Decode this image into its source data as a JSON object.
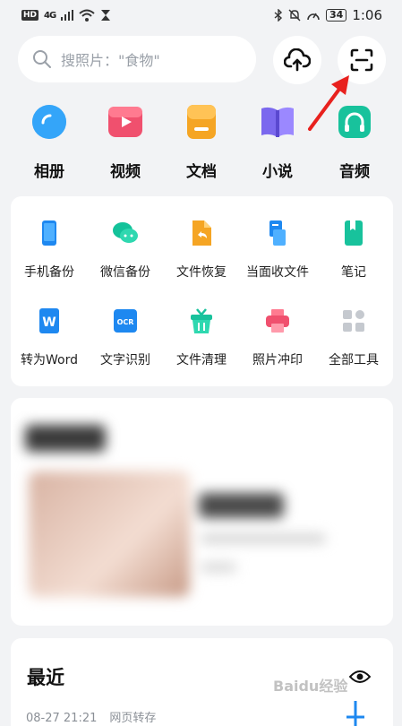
{
  "status_bar": {
    "hd": "HD",
    "network": "4G",
    "battery": "34",
    "time": "1:06"
  },
  "search": {
    "placeholder": "搜照片：\"食物\""
  },
  "categories": [
    {
      "label": "相册",
      "icon": "album-icon",
      "color": "#1e90f0"
    },
    {
      "label": "视频",
      "icon": "video-icon",
      "color": "#f0506e"
    },
    {
      "label": "文档",
      "icon": "document-icon",
      "color": "#f5a524"
    },
    {
      "label": "小说",
      "icon": "novel-icon",
      "color": "#7b68ee"
    },
    {
      "label": "音频",
      "icon": "audio-icon",
      "color": "#18c29c"
    }
  ],
  "tools": [
    {
      "label": "手机备份",
      "icon": "phone-backup-icon"
    },
    {
      "label": "微信备份",
      "icon": "wechat-backup-icon"
    },
    {
      "label": "文件恢复",
      "icon": "file-restore-icon"
    },
    {
      "label": "当面收文件",
      "icon": "receive-file-icon"
    },
    {
      "label": "笔记",
      "icon": "notes-icon"
    },
    {
      "label": "转为Word",
      "icon": "convert-word-icon"
    },
    {
      "label": "文字识别",
      "icon": "ocr-icon",
      "badge": "OCR"
    },
    {
      "label": "文件清理",
      "icon": "file-clean-icon"
    },
    {
      "label": "照片冲印",
      "icon": "photo-print-icon"
    },
    {
      "label": "全部工具",
      "icon": "all-tools-icon"
    }
  ],
  "recent": {
    "title": "最近",
    "date": "08-27 21:21",
    "source": "网页转存"
  },
  "watermark": "Baidu经验"
}
